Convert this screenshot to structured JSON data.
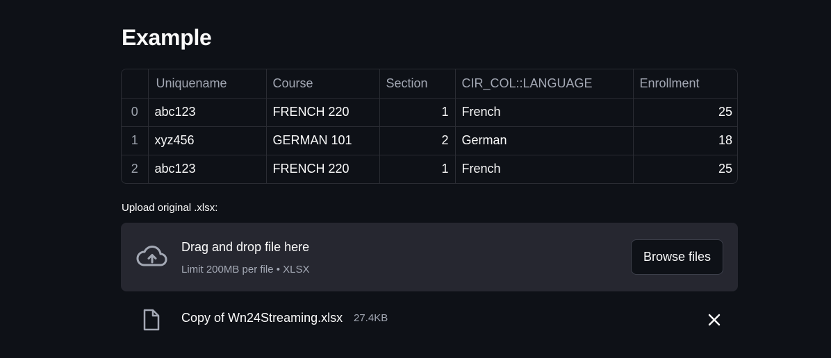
{
  "page": {
    "title": "Example"
  },
  "table": {
    "columns": [
      "",
      "Uniquename",
      "Course",
      "Section",
      "CIR_COL::LANGUAGE",
      "Enrollment"
    ],
    "rows": [
      {
        "index": "0",
        "uniquename": "abc123",
        "course": "FRENCH 220",
        "section": "1",
        "language": "French",
        "enrollment": "25"
      },
      {
        "index": "1",
        "uniquename": "xyz456",
        "course": "GERMAN 101",
        "section": "2",
        "language": "German",
        "enrollment": "18"
      },
      {
        "index": "2",
        "uniquename": "abc123",
        "course": "FRENCH 220",
        "section": "1",
        "language": "French",
        "enrollment": "25"
      }
    ]
  },
  "uploader": {
    "label": "Upload original .xlsx:",
    "drop_title": "Drag and drop file here",
    "limit_text": "Limit 200MB per file • XLSX",
    "browse_label": "Browse files",
    "icon": "cloud-upload-icon"
  },
  "uploaded_file": {
    "name": "Copy of Wn24Streaming.xlsx",
    "size": "27.4KB",
    "icon": "file-icon",
    "remove_icon": "close-icon"
  },
  "colors": {
    "background": "#0e1117",
    "dropzone": "#262730",
    "text": "#fafafa",
    "muted": "#a3a8b4"
  }
}
